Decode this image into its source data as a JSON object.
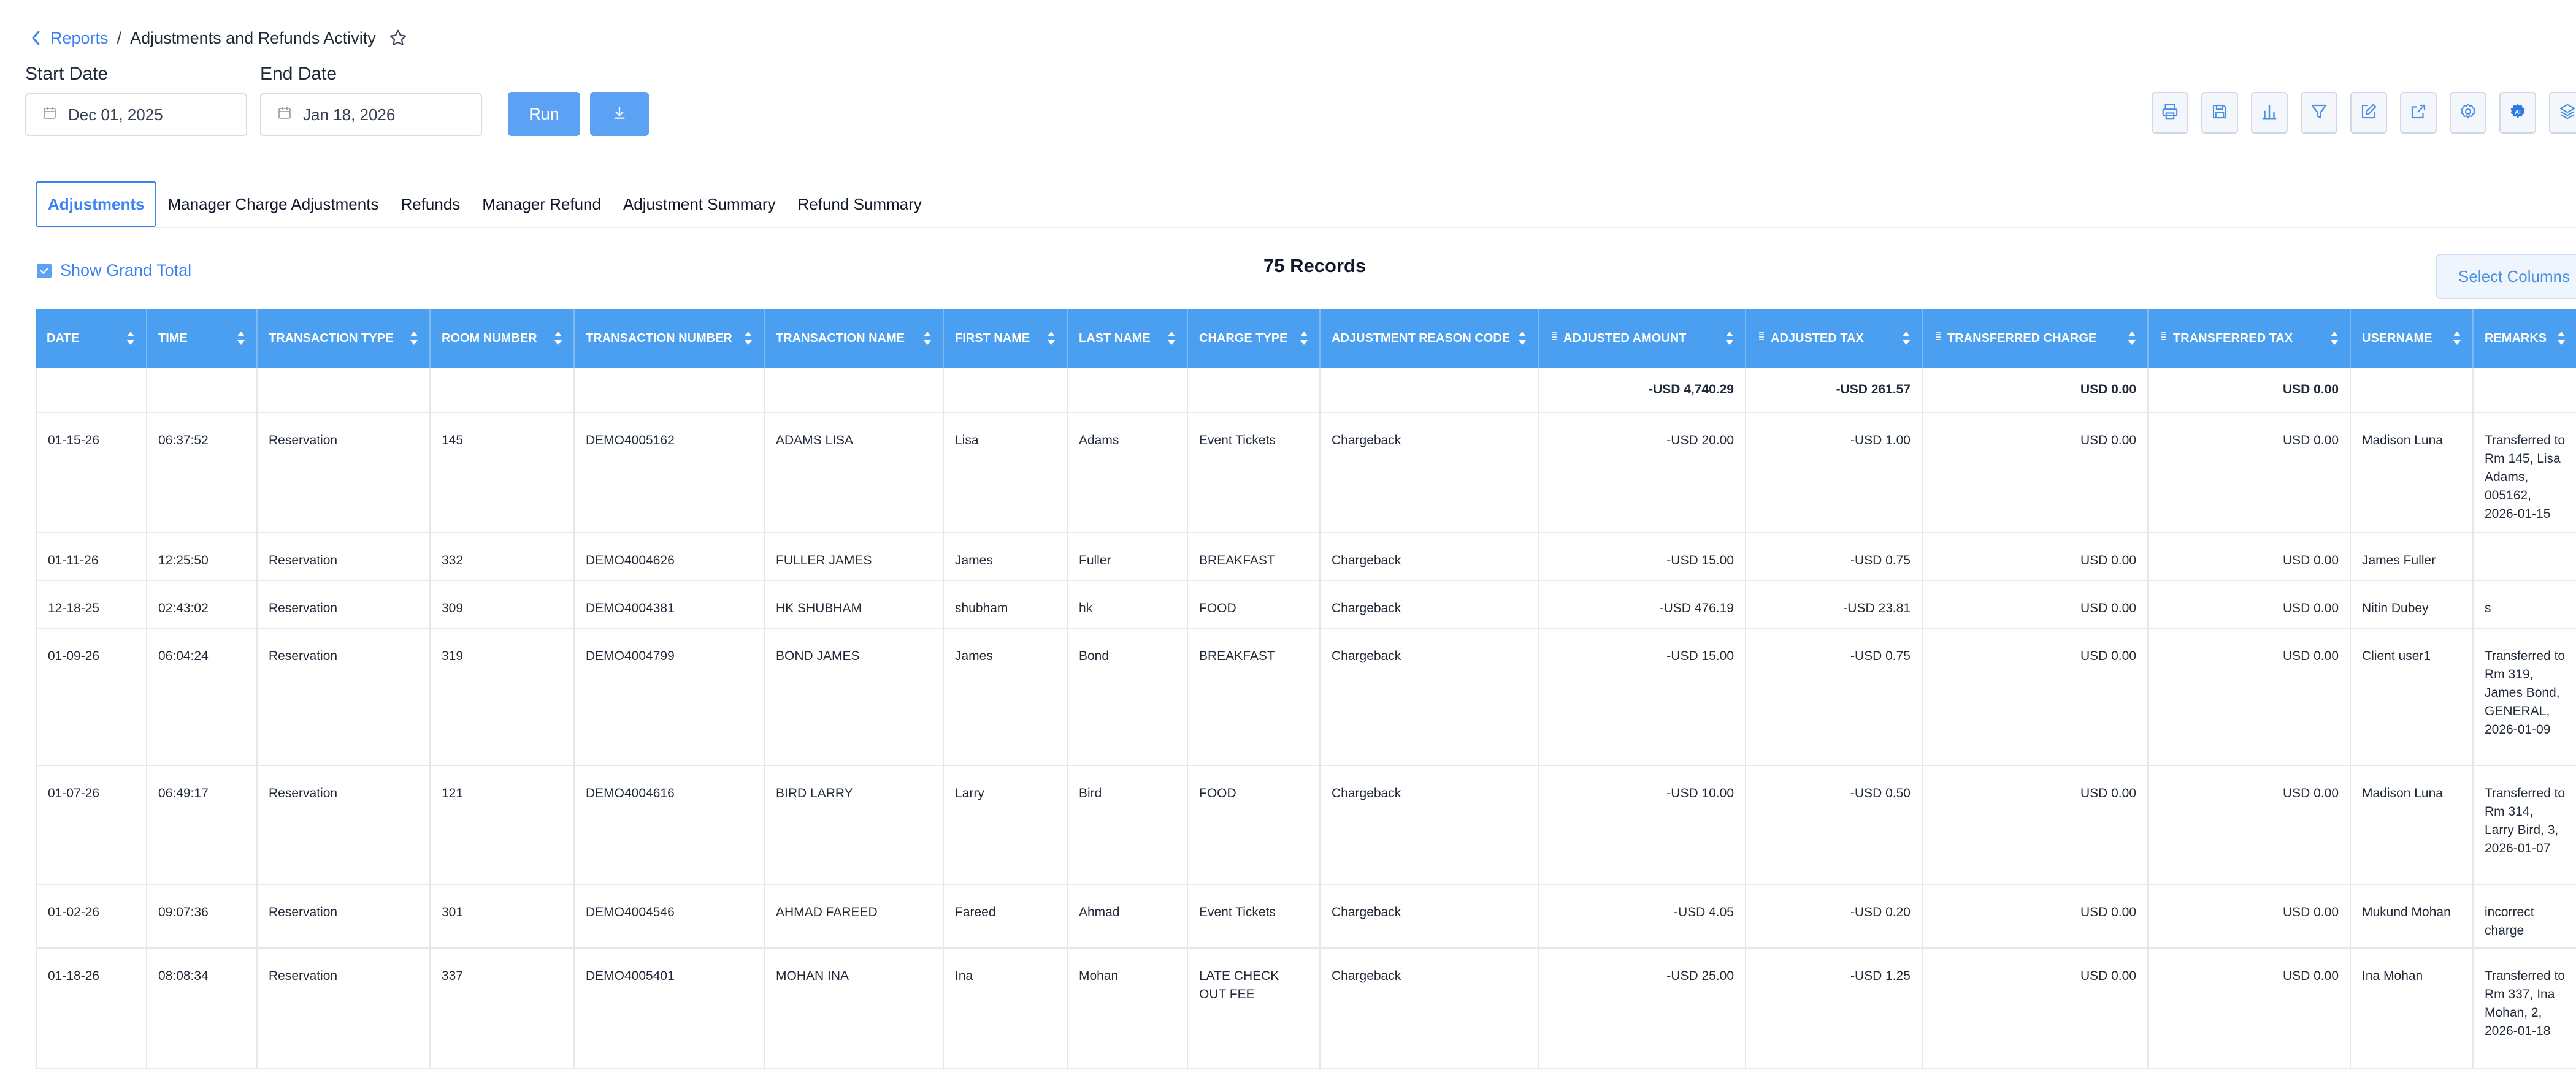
{
  "breadcrumb": {
    "back_icon": "chevron-left-icon",
    "parent": "Reports",
    "separator": "/",
    "current": "Adjustments and Refunds Activity",
    "favorite_icon": "star-outline-icon"
  },
  "filters": {
    "start_label": "Start Date",
    "start_value": "Dec 01, 2025",
    "end_label": "End Date",
    "end_value": "Jan 18, 2026",
    "calendar_icon": "calendar-icon",
    "run_label": "Run",
    "download_icon": "download-icon"
  },
  "toolbar": [
    {
      "name": "print-preview-icon"
    },
    {
      "name": "save-icon"
    },
    {
      "name": "bar-chart-icon"
    },
    {
      "name": "filter-icon"
    },
    {
      "name": "edit-icon"
    },
    {
      "name": "external-link-icon"
    },
    {
      "name": "settings-icon"
    },
    {
      "name": "ai-settings-icon"
    },
    {
      "name": "layers-icon"
    }
  ],
  "tabs": [
    {
      "label": "Adjustments",
      "active": true
    },
    {
      "label": "Manager Charge Adjustments"
    },
    {
      "label": "Refunds"
    },
    {
      "label": "Manager Refund"
    },
    {
      "label": "Adjustment Summary"
    },
    {
      "label": "Refund Summary"
    }
  ],
  "grand_total_toggle": {
    "label": "Show Grand Total",
    "checked": true
  },
  "records_label": "75 Records",
  "select_columns_label": "Select Columns",
  "table": {
    "columns": [
      {
        "label": "DATE"
      },
      {
        "label": "TIME"
      },
      {
        "label": "TRANSACTION TYPE"
      },
      {
        "label": "ROOM NUMBER"
      },
      {
        "label": "TRANSACTION NUMBER"
      },
      {
        "label": "TRANSACTION NAME"
      },
      {
        "label": "FIRST NAME"
      },
      {
        "label": "LAST NAME"
      },
      {
        "label": "CHARGE TYPE"
      },
      {
        "label": "ADJUSTMENT REASON CODE"
      },
      {
        "label": "ADJUSTED AMOUNT",
        "numeric": true
      },
      {
        "label": "ADJUSTED TAX",
        "numeric": true
      },
      {
        "label": "TRANSFERRED CHARGE",
        "numeric": true
      },
      {
        "label": "TRANSFERRED TAX",
        "numeric": true
      },
      {
        "label": "USERNAME"
      },
      {
        "label": "REMARKS"
      }
    ],
    "grand_total": [
      "",
      "",
      "",
      "",
      "",
      "",
      "",
      "",
      "",
      "",
      "-USD 4,740.29",
      "-USD 261.57",
      "USD 0.00",
      "USD 0.00",
      "",
      ""
    ],
    "rows": [
      [
        "01-15-26",
        "06:37:52",
        "Reservation",
        "145",
        "DEMO4005162",
        "ADAMS LISA",
        "Lisa",
        "Adams",
        "Event Tickets",
        "Chargeback",
        "-USD 20.00",
        "-USD 1.00",
        "USD 0.00",
        "USD 0.00",
        "Madison Luna",
        "Transferred to Rm 145, Lisa Adams, 005162, 2026-01-15"
      ],
      [
        "01-11-26",
        "12:25:50",
        "Reservation",
        "332",
        "DEMO4004626",
        "FULLER JAMES",
        "James",
        "Fuller",
        "BREAKFAST",
        "Chargeback",
        "-USD 15.00",
        "-USD 0.75",
        "USD 0.00",
        "USD 0.00",
        "James Fuller",
        ""
      ],
      [
        "12-18-25",
        "02:43:02",
        "Reservation",
        "309",
        "DEMO4004381",
        "HK SHUBHAM",
        "shubham",
        "hk",
        "FOOD",
        "Chargeback",
        "-USD 476.19",
        "-USD 23.81",
        "USD 0.00",
        "USD 0.00",
        "Nitin Dubey",
        "s"
      ],
      [
        "01-09-26",
        "06:04:24",
        "Reservation",
        "319",
        "DEMO4004799",
        "BOND JAMES",
        "James",
        "Bond",
        "BREAKFAST",
        "Chargeback",
        "-USD 15.00",
        "-USD 0.75",
        "USD 0.00",
        "USD 0.00",
        "Client user1",
        "Transferred to Rm 319, James Bond, GENERAL, 2026-01-09"
      ],
      [
        "01-07-26",
        "06:49:17",
        "Reservation",
        "121",
        "DEMO4004616",
        "BIRD LARRY",
        "Larry",
        "Bird",
        "FOOD",
        "Chargeback",
        "-USD 10.00",
        "-USD 0.50",
        "USD 0.00",
        "USD 0.00",
        "Madison Luna",
        "Transferred to Rm 314, Larry Bird, 3, 2026-01-07"
      ],
      [
        "01-02-26",
        "09:07:36",
        "Reservation",
        "301",
        "DEMO4004546",
        "AHMAD FAREED",
        "Fareed",
        "Ahmad",
        "Event Tickets",
        "Chargeback",
        "-USD 4.05",
        "-USD 0.20",
        "USD 0.00",
        "USD 0.00",
        "Mukund Mohan",
        "incorrect charge"
      ],
      [
        "01-18-26",
        "08:08:34",
        "Reservation",
        "337",
        "DEMO4005401",
        "MOHAN INA",
        "Ina",
        "Mohan",
        "LATE CHECK OUT FEE",
        "Chargeback",
        "-USD 25.00",
        "-USD 1.25",
        "USD 0.00",
        "USD 0.00",
        "Ina Mohan",
        "Transferred to Rm 337, Ina Mohan, 2, 2026-01-18"
      ]
    ]
  }
}
